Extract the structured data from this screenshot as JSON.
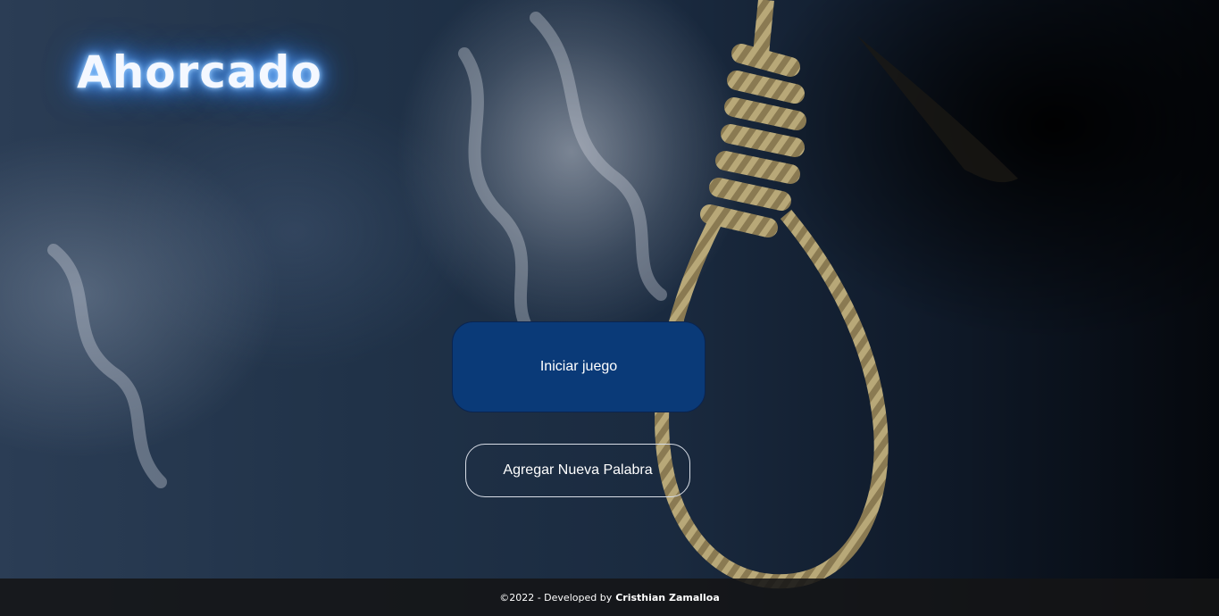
{
  "app": {
    "title": "Ahorcado"
  },
  "actions": {
    "start_label": "Iniciar juego",
    "add_word_label": "Agregar Nueva Palabra"
  },
  "footer": {
    "prefix": "©2022 - Developed by",
    "author": "Cristhian Zamalloa"
  },
  "colors": {
    "primary_button": "#0a3a78",
    "title_glow": "#3c8fff",
    "footer_bg": "#141416"
  },
  "background": {
    "image": "noose-rope-smoke"
  }
}
